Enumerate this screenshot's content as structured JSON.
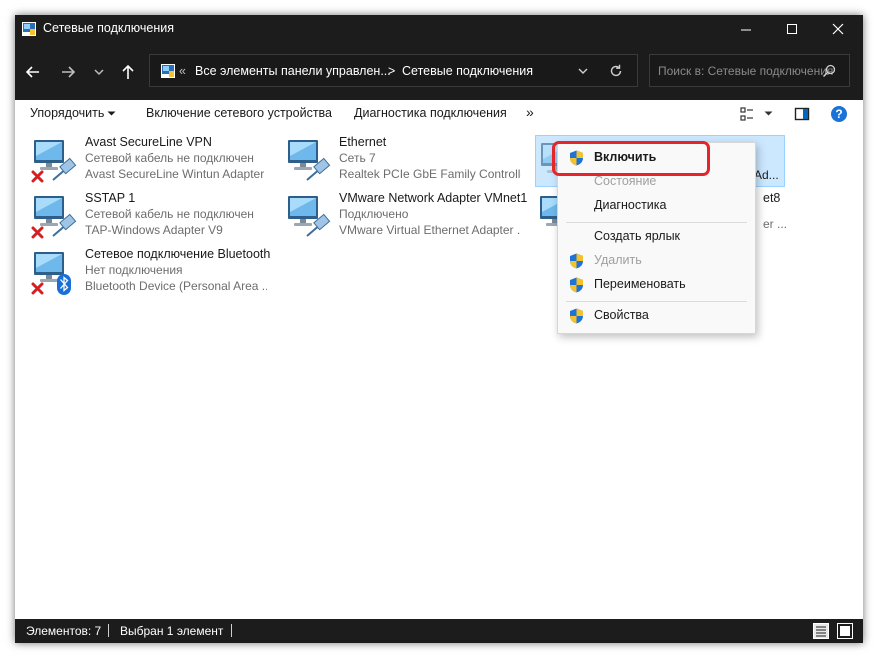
{
  "window": {
    "title": "Сетевые подключения"
  },
  "address": {
    "overflow": "«",
    "crumb1": "Все элементы панели управлен...",
    "sep": ">",
    "crumb2": "Сетевые подключения"
  },
  "search": {
    "placeholder": "Поиск в: Сетевые подключения"
  },
  "toolbar": {
    "organize": "Упорядочить",
    "enable_device": "Включение сетевого устройства",
    "diagnose": "Диагностика подключения",
    "more": "»"
  },
  "connections": [
    {
      "name": "Avast SecureLine VPN",
      "status": "Сетевой кабель не подключен",
      "adapter": "Avast SecureLine Wintun Adapter"
    },
    {
      "name": "Ethernet",
      "status": "Сеть 7",
      "adapter": "Realtek PCIe GbE Family Controller"
    },
    {
      "name": "",
      "status": "",
      "adapter": "Ad..."
    },
    {
      "name": "SSTAP 1",
      "status": "Сетевой кабель не подключен",
      "adapter": "TAP-Windows Adapter V9"
    },
    {
      "name": "VMware Network Adapter VMnet1",
      "status": "Подключено",
      "adapter": "VMware Virtual Ethernet Adapter ..."
    },
    {
      "name": "et8",
      "status": "",
      "adapter": "er ..."
    },
    {
      "name": "Сетевое подключение Bluetooth",
      "status": "Нет подключения",
      "adapter": "Bluetooth Device (Personal Area ..."
    }
  ],
  "context_menu": {
    "enable": "Включить",
    "state": "Состояние",
    "diagnostics": "Диагностика",
    "create_shortcut": "Создать ярлык",
    "delete": "Удалить",
    "rename": "Переименовать",
    "properties": "Свойства"
  },
  "statusbar": {
    "items_count": "Элементов: 7",
    "selected": "Выбран 1 элемент"
  },
  "colors": {
    "titlebar": "#1c1c1c",
    "selection": "#cce8ff",
    "highlight": "#e5252a",
    "accent": "#0067c0"
  }
}
